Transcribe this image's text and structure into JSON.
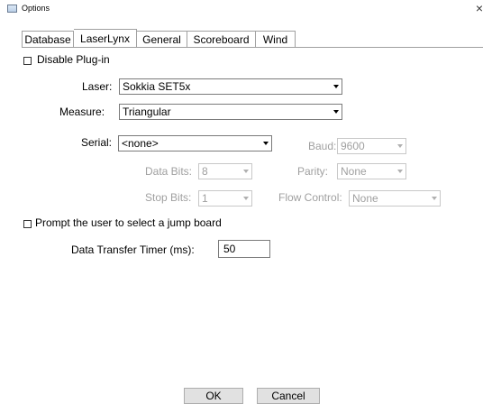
{
  "window": {
    "title": "Options",
    "close_glyph": "×",
    "icon": "window-icon"
  },
  "tabs": [
    {
      "label": "Database",
      "active": false
    },
    {
      "label": "LaserLynx",
      "active": true
    },
    {
      "label": "General",
      "active": false
    },
    {
      "label": "Scoreboard",
      "active": false
    },
    {
      "label": "Wind",
      "active": false
    }
  ],
  "form": {
    "disable_plugin": {
      "label": "Disable Plug-in",
      "checked": false
    },
    "laser": {
      "label": "Laser:",
      "value": "Sokkia SET5x"
    },
    "measure": {
      "label": "Measure:",
      "value": "Triangular"
    },
    "serial": {
      "label": "Serial:",
      "value": "<none>"
    },
    "baud": {
      "label": "Baud:",
      "value": "9600"
    },
    "data_bits": {
      "label": "Data Bits:",
      "value": "8"
    },
    "parity": {
      "label": "Parity:",
      "value": "None"
    },
    "stop_bits": {
      "label": "Stop Bits:",
      "value": "1"
    },
    "flow_control": {
      "label": "Flow Control:",
      "value": "None"
    },
    "prompt_jump_board": {
      "label": "Prompt the user to select a jump board",
      "checked": false
    },
    "data_transfer_timer": {
      "label": "Data Transfer Timer (ms):",
      "value": "50"
    }
  },
  "buttons": {
    "ok": "OK",
    "cancel": "Cancel"
  }
}
